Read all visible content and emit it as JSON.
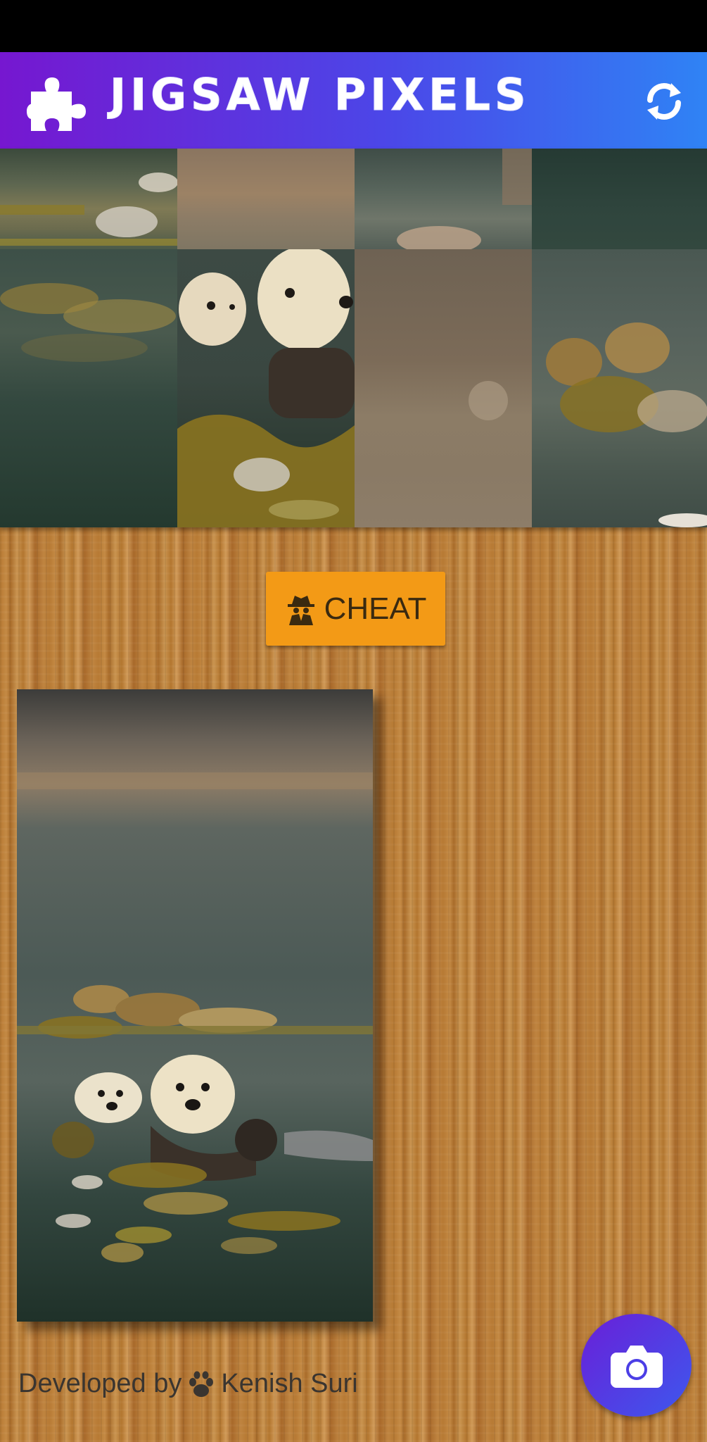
{
  "app": {
    "title": "JIGSAW PIXELS",
    "logo_icon": "puzzle-piece-icon",
    "refresh_icon": "refresh-icon"
  },
  "colors": {
    "app_bar_start": "#7617d0",
    "app_bar_end": "#2f83f5",
    "cheat_button": "#f39a16",
    "fab_start": "#6a1fd8",
    "fab_end": "#3d58ee"
  },
  "puzzle": {
    "columns": 4,
    "rows": 2,
    "tiles": [
      {
        "content": "water with kelp and bubbles"
      },
      {
        "content": "blurred brown shore"
      },
      {
        "content": "water with pebble"
      },
      {
        "content": "dark green water"
      },
      {
        "content": "kelp and dark water"
      },
      {
        "content": "two sea otters heads"
      },
      {
        "content": "blurred brown shore"
      },
      {
        "content": "kelp cluster in water"
      }
    ]
  },
  "cheat_button": {
    "label": "CHEAT",
    "icon": "spy-icon"
  },
  "reference": {
    "description_icon": "reference-photo"
  },
  "footer": {
    "prefix": "Developed by",
    "icon": "paw-icon",
    "author": "Kenish Suri"
  },
  "camera_button": {
    "icon": "camera-icon"
  }
}
